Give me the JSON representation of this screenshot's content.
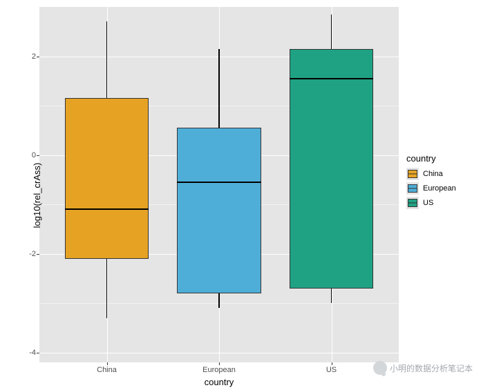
{
  "chart_data": {
    "type": "boxplot",
    "xlabel": "country",
    "ylabel": "log10(rel_crAss)",
    "categories": [
      "China",
      "European",
      "US"
    ],
    "ylim": [
      -4.2,
      3.0
    ],
    "y_ticks": [
      -4,
      -2,
      0,
      2
    ],
    "series": [
      {
        "name": "China",
        "color": "#e6a323",
        "min": -3.3,
        "q1": -2.1,
        "median": -1.1,
        "q3": 1.15,
        "max": 2.7
      },
      {
        "name": "European",
        "color": "#4eaed7",
        "min": -3.1,
        "q1": -2.8,
        "median": -0.55,
        "q3": 0.55,
        "max": 2.15
      },
      {
        "name": "US",
        "color": "#1fa283",
        "min": -3.0,
        "q1": -2.7,
        "median": 1.55,
        "q3": 2.15,
        "max": 2.85
      }
    ]
  },
  "legend": {
    "title": "country",
    "items": [
      {
        "label": "China",
        "color": "#e6a323"
      },
      {
        "label": "European",
        "color": "#4eaed7"
      },
      {
        "label": "US",
        "color": "#1fa283"
      }
    ]
  },
  "watermark": {
    "text": "小明的数据分析笔记本"
  }
}
